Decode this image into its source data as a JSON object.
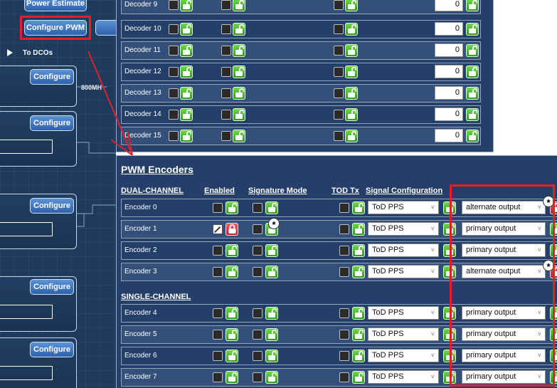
{
  "left_canvas": {
    "buttons": {
      "power_estimate": "Power Estimate",
      "configure_pwm": "Configure PWM",
      "configure": "Configure"
    },
    "to_dcos": "To DCOs",
    "freq_label": "800MH"
  },
  "decoders": [
    {
      "label": "Decoder 9",
      "value": "0"
    },
    {
      "label": "Decoder 10",
      "value": "0"
    },
    {
      "label": "Decoder 11",
      "value": "0"
    },
    {
      "label": "Decoder 12",
      "value": "0"
    },
    {
      "label": "Decoder 13",
      "value": "0"
    },
    {
      "label": "Decoder 14",
      "value": "0"
    },
    {
      "label": "Decoder 15",
      "value": "0"
    }
  ],
  "pwm_encoders": {
    "title": "PWM Encoders",
    "headers": {
      "dual_channel": "DUAL-CHANNEL",
      "enabled": "Enabled",
      "signature_mode": "Signature Mode",
      "tod_tx": "TOD Tx",
      "signal_configuration": "Signal Configuration"
    },
    "single_channel": "SINGLE-CHANNEL",
    "encoders": [
      {
        "label": "Encoder 0",
        "enabled": false,
        "enabled_locked": false,
        "signal": "ToD PPS",
        "output": "alternate output"
      },
      {
        "label": "Encoder 1",
        "enabled": true,
        "enabled_locked": true,
        "signal": "ToD PPS",
        "output": "primary output"
      },
      {
        "label": "Encoder 2",
        "enabled": false,
        "enabled_locked": false,
        "signal": "ToD PPS",
        "output": "primary output"
      },
      {
        "label": "Encoder 3",
        "enabled": false,
        "enabled_locked": false,
        "signal": "ToD PPS",
        "output": "alternate output"
      },
      {
        "label": "Encoder 4",
        "enabled": false,
        "enabled_locked": false,
        "signal": "ToD PPS",
        "output": "primary output"
      },
      {
        "label": "Encoder 5",
        "enabled": false,
        "enabled_locked": false,
        "signal": "ToD PPS",
        "output": "primary output"
      },
      {
        "label": "Encoder 6",
        "enabled": false,
        "enabled_locked": false,
        "signal": "ToD PPS",
        "output": "primary output"
      },
      {
        "label": "Encoder 7",
        "enabled": false,
        "enabled_locked": false,
        "signal": "ToD PPS",
        "output": "primary output"
      }
    ]
  },
  "colors": {
    "panel_bg": "#24406a",
    "row_alt_bg": "#33507a",
    "lock_green": "#3fb92a",
    "lock_red": "#d0303a",
    "annotation_red": "#e0202a"
  },
  "icons": {
    "unlock": "open-padlock-icon",
    "locked": "closed-padlock-icon",
    "asterisk_badge": "asterisk-badge-icon",
    "dropdown": "chevron-down-icon"
  }
}
